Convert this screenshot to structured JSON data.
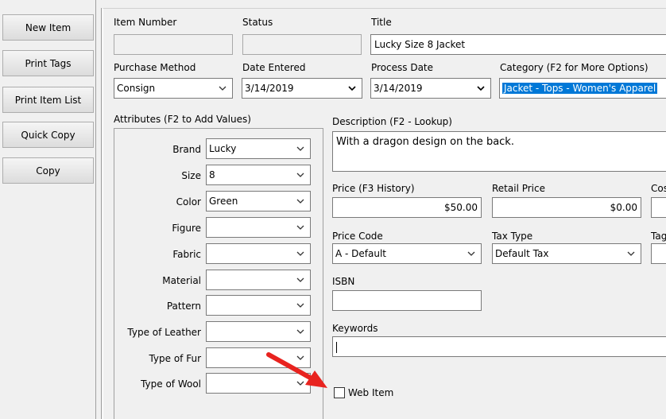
{
  "left_panel": {
    "buttons": [
      "New Item",
      "Print Tags",
      "Print Item List",
      "Quick Copy",
      "Copy"
    ]
  },
  "fields": {
    "item_number": {
      "label": "Item Number",
      "value": ""
    },
    "status": {
      "label": "Status",
      "value": ""
    },
    "title": {
      "label": "Title",
      "value": "Lucky Size 8 Jacket"
    },
    "purchase_method": {
      "label": "Purchase Method",
      "value": "Consign"
    },
    "date_entered": {
      "label": "Date Entered",
      "value": "3/14/2019"
    },
    "process_date": {
      "label": "Process Date",
      "value": "3/14/2019"
    },
    "category": {
      "label": "Category (F2 for More Options)",
      "value": "Jacket - Tops - Women's Apparel"
    }
  },
  "attributes": {
    "group_label": "Attributes (F2 to Add Values)",
    "items": [
      {
        "label": "Brand",
        "value": "Lucky"
      },
      {
        "label": "Size",
        "value": "8"
      },
      {
        "label": "Color",
        "value": "Green"
      },
      {
        "label": "Figure",
        "value": ""
      },
      {
        "label": "Fabric",
        "value": ""
      },
      {
        "label": "Material",
        "value": ""
      },
      {
        "label": "Pattern",
        "value": ""
      },
      {
        "label": "Type of Leather",
        "value": ""
      },
      {
        "label": "Type of Fur",
        "value": ""
      },
      {
        "label": "Type of Wool",
        "value": ""
      }
    ]
  },
  "description": {
    "label": "Description (F2 - Lookup)",
    "value": "With a dragon design on the back."
  },
  "price": {
    "label": "Price (F3 History)",
    "value": "$50.00"
  },
  "retail_price": {
    "label": "Retail Price",
    "value": "$0.00"
  },
  "cost": {
    "label": "Cos",
    "value": ""
  },
  "price_code": {
    "label": "Price Code",
    "value": "A - Default"
  },
  "tax_type": {
    "label": "Tax Type",
    "value": "Default Tax"
  },
  "tag": {
    "label": "Tag",
    "value": ""
  },
  "isbn": {
    "label": "ISBN",
    "value": ""
  },
  "keywords": {
    "label": "Keywords",
    "value": ""
  },
  "web_item": {
    "label": "Web Item",
    "checked": false
  },
  "annotation": {
    "arrow_color": "#e8231f"
  },
  "icons": {
    "dropdown": "chevron-down-icon"
  }
}
